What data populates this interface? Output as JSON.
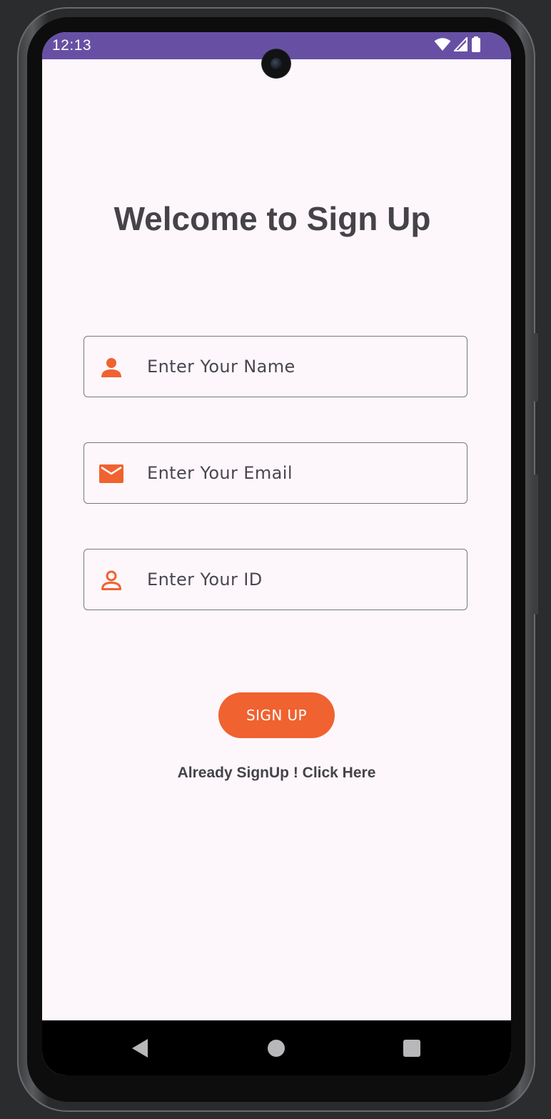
{
  "status_bar": {
    "time": "12:13",
    "icons": [
      "wifi-icon",
      "cellular-signal-icon",
      "battery-icon"
    ],
    "background_color": "#6750a4"
  },
  "form": {
    "title": "Welcome to Sign Up",
    "fields": [
      {
        "name": "name",
        "icon": "person-icon",
        "placeholder": "Enter Your Name",
        "value": ""
      },
      {
        "name": "email",
        "icon": "mail-icon",
        "placeholder": "Enter Your Email",
        "value": ""
      },
      {
        "name": "id",
        "icon": "person-outline-icon",
        "placeholder": "Enter Your ID",
        "value": ""
      }
    ],
    "submit_label": "SIGN UP",
    "login_link": "Already SignUp ! Click Here"
  },
  "nav_bar": {
    "buttons": [
      "back-icon",
      "home-icon",
      "recents-icon"
    ]
  },
  "colors": {
    "accent": "#f06230",
    "screen_background": "#fdf7fc",
    "text": "#454348"
  }
}
